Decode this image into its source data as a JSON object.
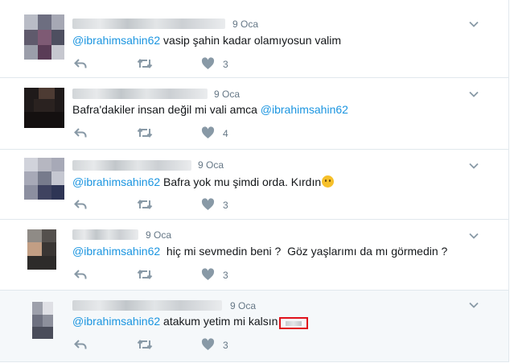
{
  "tweets": [
    {
      "date": "9 Oca",
      "mention": "@ibrahimsahin62",
      "text": " vasip şahin kadar olamıyosun valim",
      "likes": "3",
      "emoji": false,
      "redacted_box": false
    },
    {
      "date": "9 Oca",
      "mention": "@ibrahimsahin62",
      "text_before": "Bafra'dakiler insan değil mi vali amca ",
      "likes": "4"
    },
    {
      "date": "9 Oca",
      "mention": "@ibrahimsahin62",
      "text": " Bafra yok mu şimdi orda. Kırdın",
      "likes": "3",
      "emoji": "face-without-mouth-emoji"
    },
    {
      "date": "9 Oca",
      "mention": "@ibrahimsahin62",
      "text": "  hiç mi sevmedin beni ?  Göz yaşlarımı da mı görmedin ?",
      "likes": "3"
    },
    {
      "date": "9 Oca",
      "mention": "@ibrahimsahin62",
      "text": " atakum yetim mi kalsın",
      "likes": "3",
      "redacted_box": true
    }
  ],
  "icons": {
    "reply": "reply-icon",
    "retweet": "retweet-icon",
    "like": "heart-icon",
    "menu": "chevron-down-icon"
  },
  "colors": {
    "mention": "#1b95e0",
    "meta": "#657786",
    "icon": "#8899a6",
    "divider": "#e1e8ed",
    "highlight": "#f5f8fa",
    "redbox": "#e0111b"
  }
}
